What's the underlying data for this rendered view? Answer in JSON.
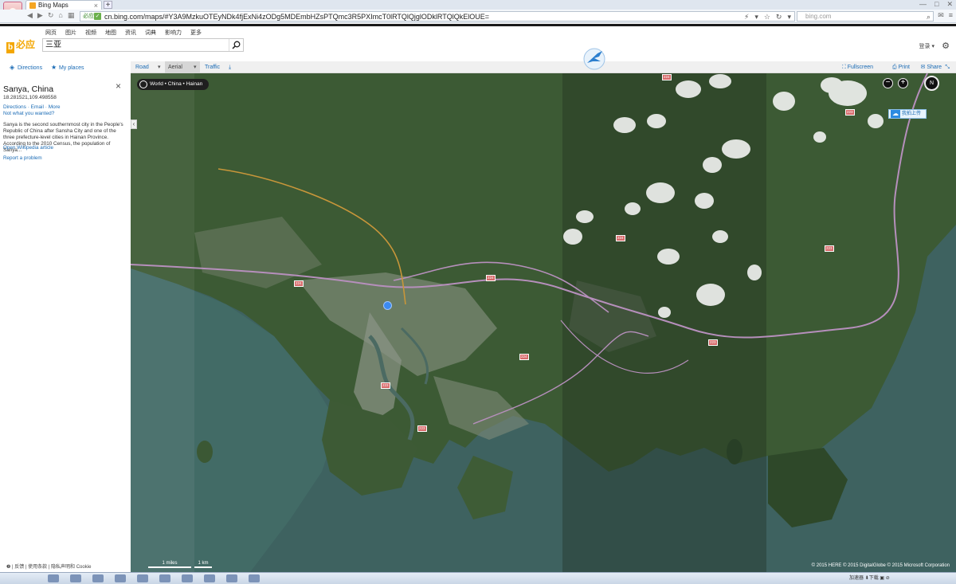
{
  "browser": {
    "tab_title": "Bing Maps",
    "tab_close": "×",
    "new_tab": "+",
    "url_secure_label": "必应",
    "url": "cn.bing.com/maps/#Y3A9MzkuOTEyNDk4fjExNi4zODg5MDEmbHZsPTQmc3R5PXImcT0lRTQlQjglODklRTQlQkElOUE=",
    "search_placeholder": "bing.com"
  },
  "bing": {
    "logo_text": "必应",
    "scopes": [
      "网页",
      "图片",
      "视频",
      "地图",
      "资讯",
      "词典",
      "影响力",
      "更多"
    ],
    "search_value": "三亚",
    "signin_label": "登录"
  },
  "left_panel": {
    "directions_label": "Directions",
    "my_places_label": "My places",
    "place_title": "Sanya, China",
    "close": "×",
    "coords": "18.281521,109.498558",
    "links": "Directions · Email · More",
    "not_wanted": "Not what you wanted?",
    "description": "Sanya is the second southernmost city in the People's Republic of China after Sansha City and one of the three prefecture-level cities in Hainan Province. According to the 2010 Census, the population of Sanya...",
    "wiki_link": "Open Wikipedia article",
    "report_link": "Report a problem",
    "footer": "❷  |  反馈  |  使用条款  |  隐私声明和 Cookie"
  },
  "map_toolbar": {
    "road": "Road",
    "aerial": "Aerial",
    "traffic": "Traffic",
    "fullscreen": "Fullscreen",
    "print": "Print",
    "share": "Share"
  },
  "map": {
    "breadcrumb": "World • China • Hainan",
    "upload_label": "我拍上传",
    "compass_label": "N",
    "road_shields": [
      "224",
      "223",
      "224",
      "223",
      "224",
      "224",
      "223",
      "224",
      "223",
      "223"
    ],
    "scale_miles": "1 miles",
    "scale_km": "1 km",
    "copyright": "© 2015 HERE   © 2015 DigitalGlobe   © 2015 Microsoft Corporation"
  },
  "taskbar": {
    "status": "加速器  ⬇下载  ▣  ⊘"
  },
  "colors": {
    "link": "#1a6bb5",
    "bing_yellow": "#f4a700",
    "map_land": "#3a5736",
    "map_sea": "#3d6466"
  }
}
